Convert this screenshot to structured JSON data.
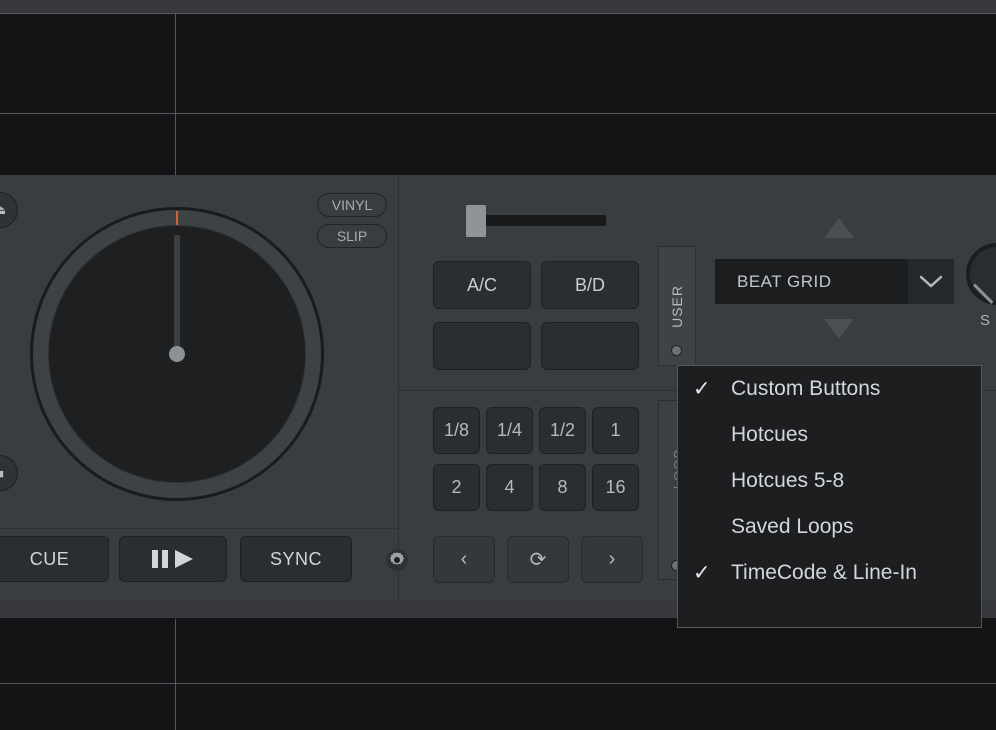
{
  "deck": {
    "jog": {
      "name": "jog-wheel",
      "tick_color": "#d1632a"
    },
    "edge_buttons": [
      {
        "name": "eject-button",
        "glyph": "⏏"
      },
      {
        "name": "stop-button",
        "glyph": "■"
      }
    ],
    "mode_pills": [
      {
        "label": "VINYL"
      },
      {
        "label": "SLIP"
      }
    ],
    "tempo_slider": {
      "name": "tempo-slider",
      "value_position": "min"
    },
    "source_pads": [
      {
        "label": "A/C"
      },
      {
        "label": "B/D"
      },
      {
        "label": ""
      },
      {
        "label": ""
      }
    ],
    "loop_sizes": [
      "1/8",
      "1/4",
      "1/2",
      "1",
      "2",
      "4",
      "8",
      "16"
    ],
    "loop_nav": [
      {
        "name": "loop-prev-button",
        "glyph": "‹"
      },
      {
        "name": "reloop-button",
        "glyph": "⟳"
      },
      {
        "name": "loop-next-button",
        "glyph": "›"
      }
    ],
    "user_tab": {
      "label": "USER"
    },
    "side_tab": {
      "label": "LOOP"
    },
    "beat_grid": {
      "value": "BEAT GRID",
      "chevron": "⌄",
      "up_arrow": "▲",
      "down_arrow": "▼"
    },
    "knob": {
      "label": "S"
    },
    "transport": {
      "cue": "CUE",
      "play_pause": "▐▐ ▶",
      "sync": "SYNC",
      "settings_icon": "gear-icon"
    }
  },
  "context_menu": {
    "items": [
      {
        "label": "Custom Buttons",
        "checked": true,
        "check": "✓"
      },
      {
        "label": "Hotcues",
        "checked": false,
        "check": ""
      },
      {
        "label": "Hotcues 5-8",
        "checked": false,
        "check": ""
      },
      {
        "label": "Saved Loops",
        "checked": false,
        "check": ""
      },
      {
        "label": "TimeCode & Line-In",
        "checked": true,
        "check": "✓"
      }
    ]
  },
  "colors": {
    "panel": "#3a3d40",
    "waveform_bg": "#121416",
    "strip": "#36383b",
    "menu_bg": "#1c1e20",
    "text": "#d3d6da",
    "accent": "#d1632a"
  }
}
